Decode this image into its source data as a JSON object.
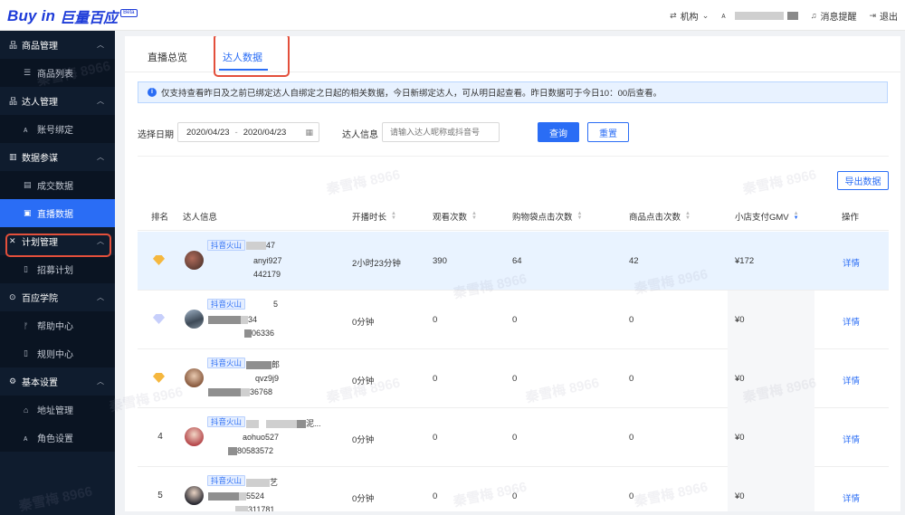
{
  "header": {
    "logo_text": "Buy in",
    "logo_cn": "巨量百应",
    "logo_badge": "Beta",
    "org_label": "机构",
    "notify_label": "消息提醒",
    "logout_label": "退出"
  },
  "sidebar": {
    "groups": [
      {
        "label": "商品管理",
        "items": [
          "商品列表"
        ]
      },
      {
        "label": "达人管理",
        "items": [
          "账号绑定"
        ]
      },
      {
        "label": "数据参谋",
        "items": [
          "成交数据",
          "直播数据"
        ]
      },
      {
        "label": "计划管理",
        "items": [
          "招募计划"
        ]
      },
      {
        "label": "百应学院",
        "items": [
          "帮助中心",
          "规则中心"
        ]
      },
      {
        "label": "基本设置",
        "items": [
          "地址管理",
          "角色设置"
        ]
      }
    ],
    "active_item": "直播数据"
  },
  "tabs": {
    "overview": "直播总览",
    "talent": "达人数据",
    "active": "达人数据"
  },
  "notice": {
    "text": "仅支持查看昨日及之前已绑定达人自绑定之日起的相关数据，今日新绑定达人，可从明日起查看。昨日数据可于今日10：00后查看。"
  },
  "filters": {
    "date_label": "选择日期",
    "date_start": "2020/04/23",
    "date_end": "2020/04/23",
    "info_label": "达人信息",
    "info_placeholder": "请输入达人昵称或抖音号",
    "query_btn": "查询",
    "reset_btn": "重置"
  },
  "export_btn": "导出数据",
  "table": {
    "columns": [
      "排名",
      "达人信息",
      "开播时长",
      "观看次数",
      "购物袋点击次数",
      "商品点击次数",
      "小店支付GMV",
      "操作"
    ],
    "rows": [
      {
        "rank": "",
        "medal": "gold",
        "tag": "抖音火山",
        "l1": "47",
        "l2": "anyi927",
        "l3": "442179",
        "duration": "2小时23分钟",
        "views": "390",
        "bag_clicks": "64",
        "product_clicks": "42",
        "gmv": "¥172",
        "action": "详情"
      },
      {
        "rank": "",
        "medal": "silver",
        "tag": "抖音火山",
        "l1": "5",
        "l2": "34",
        "l3": "06336",
        "duration": "0分钟",
        "views": "0",
        "bag_clicks": "0",
        "product_clicks": "0",
        "gmv": "¥0",
        "action": "详情"
      },
      {
        "rank": "",
        "medal": "gold",
        "tag": "抖音火山",
        "l1": "郎",
        "l2": "qvz9j9",
        "l3": "36768",
        "duration": "0分钟",
        "views": "0",
        "bag_clicks": "0",
        "product_clicks": "0",
        "gmv": "¥0",
        "action": "详情"
      },
      {
        "rank": "4",
        "medal": "",
        "tag": "抖音火山",
        "l1": "泥...",
        "l2": "aohuo527",
        "l3": "80583572",
        "duration": "0分钟",
        "views": "0",
        "bag_clicks": "0",
        "product_clicks": "0",
        "gmv": "¥0",
        "action": "详情"
      },
      {
        "rank": "5",
        "medal": "",
        "tag": "抖音火山",
        "l1": "艺",
        "l2": "5524",
        "l3": "311781",
        "duration": "0分钟",
        "views": "0",
        "bag_clicks": "0",
        "product_clicks": "0",
        "gmv": "¥0",
        "action": "详情"
      }
    ]
  },
  "watermark": "秦雪梅 8966"
}
